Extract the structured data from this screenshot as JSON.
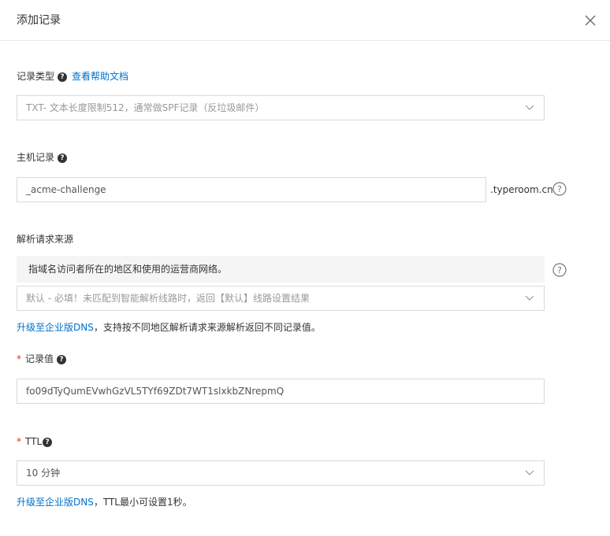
{
  "dialog": {
    "title": "添加记录"
  },
  "record_type": {
    "label": "记录类型",
    "help_link": "查看帮助文档",
    "value": "TXT- 文本长度限制512，通常做SPF记录（反垃圾邮件）"
  },
  "host_record": {
    "label": "主机记录",
    "value": "_acme-challenge",
    "suffix": ".typeroom.cn"
  },
  "resolve_source": {
    "label": "解析请求来源",
    "tip": "指域名访问者所在的地区和使用的运营商网络。",
    "value": "默认 - 必填！未匹配到智能解析线路时，返回【默认】线路设置结果",
    "upgrade_link": "升级至企业版DNS",
    "upgrade_note": "，支持按不同地区解析请求来源解析返回不同记录值。"
  },
  "record_value": {
    "required_mark": "*",
    "label": "记录值",
    "value": "fo09dTyQumEVwhGzVL5TYf69ZDt7WT1slxkbZNrepmQ"
  },
  "ttl": {
    "required_mark": "*",
    "label": "TTL",
    "value": "10 分钟",
    "upgrade_link": "升级至企业版DNS",
    "upgrade_note": "，TTL最小可设置1秒。"
  },
  "icons": {
    "close": "close-icon",
    "help": "question-circle-icon",
    "dropdown": "chevron-down-icon"
  },
  "colors": {
    "link": "#0070cc",
    "required": "#d93026",
    "border": "#d9d9d9",
    "tip_bg": "#f5f5f5"
  }
}
